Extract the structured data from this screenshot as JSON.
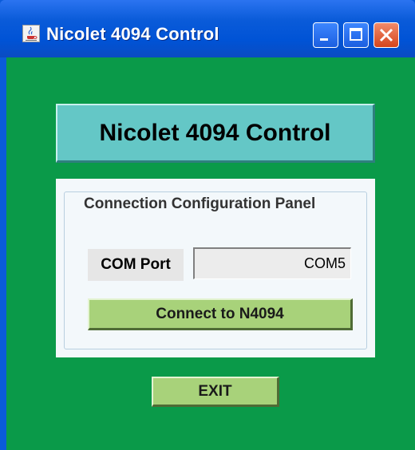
{
  "window": {
    "title": "Nicolet 4094 Control",
    "controls": [
      "minimize-icon",
      "maximize-icon",
      "close-icon"
    ],
    "app_icon": "java-cup-icon"
  },
  "main": {
    "heading": "Nicolet 4094 Control",
    "panel": {
      "legend": "Connection Configuration Panel",
      "com_port": {
        "label": "COM Port",
        "value": "COM5"
      },
      "connect_label": "Connect to N4094"
    },
    "exit_label": "EXIT"
  },
  "colors": {
    "background": "#0a9a49",
    "heading_bg": "#64c7c6",
    "button_bg": "#a8d27a",
    "panel_bg": "#f3f8fb",
    "titlebar": "#0a5bd9"
  }
}
